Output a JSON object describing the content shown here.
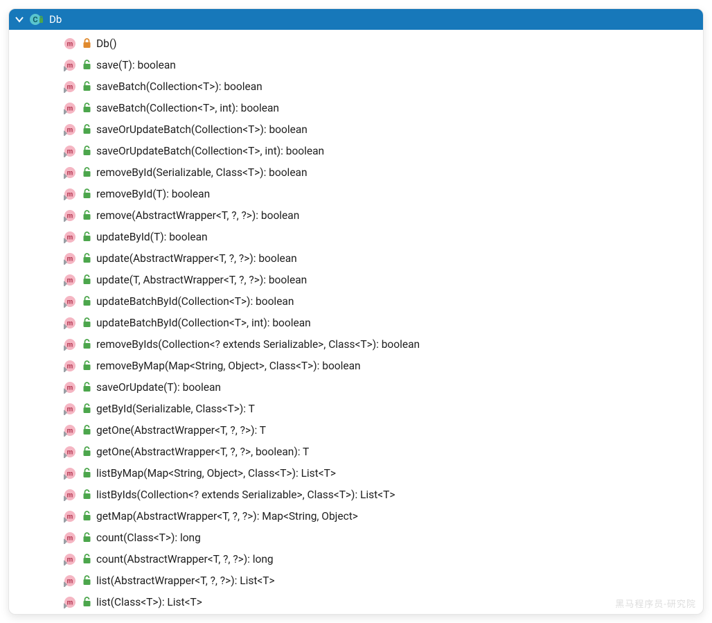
{
  "header": {
    "title": "Db"
  },
  "colors": {
    "header_bg": "#1778BA",
    "method_pink": "#F5B6C3",
    "method_m": "#B43651",
    "lock_green": "#4CA64C",
    "lock_orange": "#E08A2E",
    "class_circle": "#59C5CE"
  },
  "members": [
    {
      "kind": "constructor",
      "lock": "orange",
      "label": "Db()"
    },
    {
      "kind": "method-static",
      "lock": "green",
      "label": "save(T): boolean"
    },
    {
      "kind": "method-static",
      "lock": "green",
      "label": "saveBatch(Collection<T>): boolean"
    },
    {
      "kind": "method-static",
      "lock": "green",
      "label": "saveBatch(Collection<T>, int): boolean"
    },
    {
      "kind": "method-static",
      "lock": "green",
      "label": "saveOrUpdateBatch(Collection<T>): boolean"
    },
    {
      "kind": "method-static",
      "lock": "green",
      "label": "saveOrUpdateBatch(Collection<T>, int): boolean"
    },
    {
      "kind": "method-static",
      "lock": "green",
      "label": "removeById(Serializable, Class<T>): boolean"
    },
    {
      "kind": "method-static",
      "lock": "green",
      "label": "removeById(T): boolean"
    },
    {
      "kind": "method-static",
      "lock": "green",
      "label": "remove(AbstractWrapper<T, ?, ?>): boolean"
    },
    {
      "kind": "method-static",
      "lock": "green",
      "label": "updateById(T): boolean"
    },
    {
      "kind": "method-static",
      "lock": "green",
      "label": "update(AbstractWrapper<T, ?, ?>): boolean"
    },
    {
      "kind": "method-static",
      "lock": "green",
      "label": "update(T, AbstractWrapper<T, ?, ?>): boolean"
    },
    {
      "kind": "method-static",
      "lock": "green",
      "label": "updateBatchById(Collection<T>): boolean"
    },
    {
      "kind": "method-static",
      "lock": "green",
      "label": "updateBatchById(Collection<T>, int): boolean"
    },
    {
      "kind": "method-static",
      "lock": "green",
      "label": "removeByIds(Collection<? extends Serializable>, Class<T>): boolean"
    },
    {
      "kind": "method-static",
      "lock": "green",
      "label": "removeByMap(Map<String, Object>, Class<T>): boolean"
    },
    {
      "kind": "method-static",
      "lock": "green",
      "label": "saveOrUpdate(T): boolean"
    },
    {
      "kind": "method-static",
      "lock": "green",
      "label": "getById(Serializable, Class<T>): T"
    },
    {
      "kind": "method-static",
      "lock": "green",
      "label": "getOne(AbstractWrapper<T, ?, ?>): T"
    },
    {
      "kind": "method-static",
      "lock": "green",
      "label": "getOne(AbstractWrapper<T, ?, ?>, boolean): T"
    },
    {
      "kind": "method-static",
      "lock": "green",
      "label": "listByMap(Map<String, Object>, Class<T>): List<T>"
    },
    {
      "kind": "method-static",
      "lock": "green",
      "label": "listByIds(Collection<? extends Serializable>, Class<T>): List<T>"
    },
    {
      "kind": "method-static",
      "lock": "green",
      "label": "getMap(AbstractWrapper<T, ?, ?>): Map<String, Object>"
    },
    {
      "kind": "method-static",
      "lock": "green",
      "label": "count(Class<T>): long"
    },
    {
      "kind": "method-static",
      "lock": "green",
      "label": "count(AbstractWrapper<T, ?, ?>): long"
    },
    {
      "kind": "method-static",
      "lock": "green",
      "label": "list(AbstractWrapper<T, ?, ?>): List<T>"
    },
    {
      "kind": "method-static",
      "lock": "green",
      "label": "list(Class<T>): List<T>"
    }
  ],
  "watermark": "黑马程序员-研究院"
}
